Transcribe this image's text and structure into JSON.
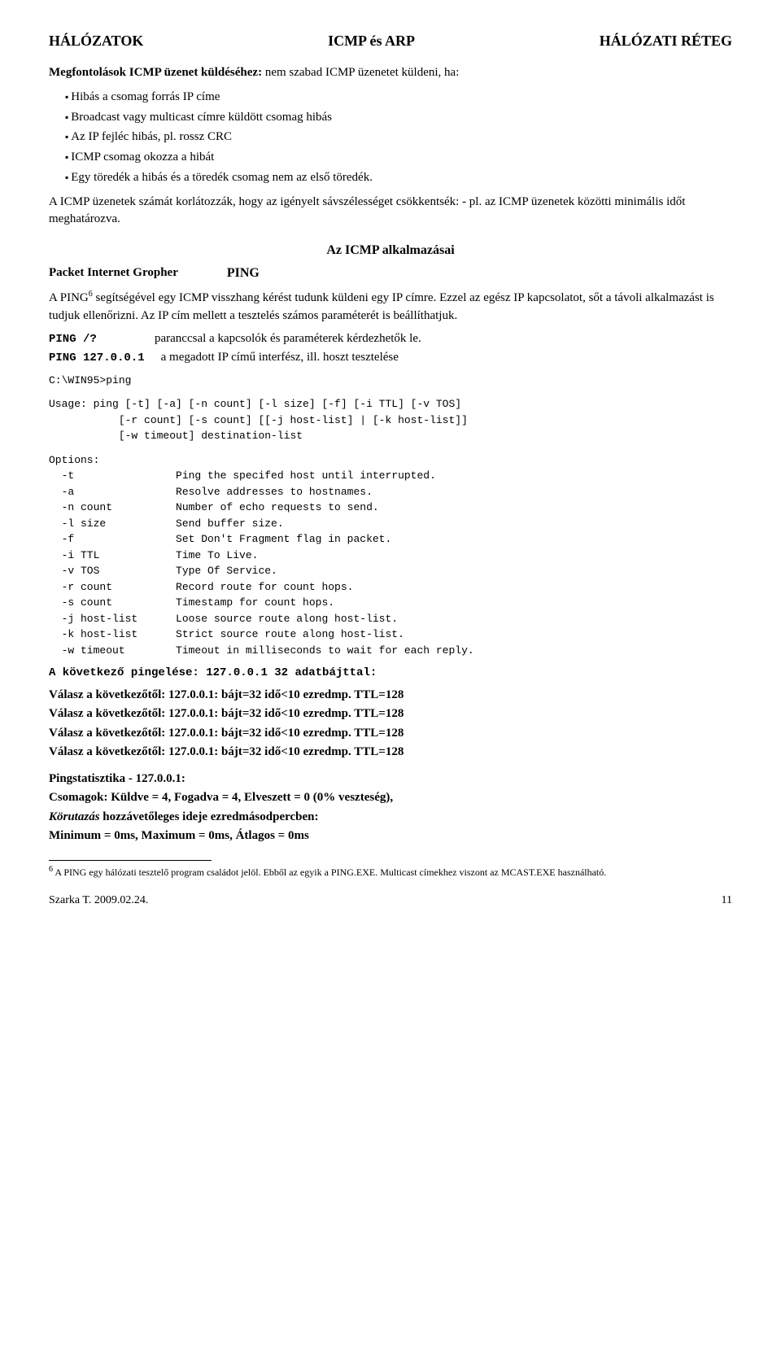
{
  "header": {
    "left": "HÁLÓZATOK",
    "center": "ICMP és ARP",
    "right": "HÁLÓZATI RÉTEG"
  },
  "intro": {
    "bold_prefix": "Megfontolások ICMP üzenet küldéséhez:",
    "bold_suffix": " nem szabad ICMP üzenetet küldeni, ha:",
    "bullets": [
      "Hibás a csomag forrás IP címe",
      "Broadcast vagy multicast címre küldött csomag hibás",
      "Az IP fejléc hibás, pl. rossz CRC",
      "ICMP csomag okozza a hibát",
      "Egy töredék a hibás és a töredék csomag nem az első töredék."
    ]
  },
  "limitation": {
    "text1": "A ICMP üzenetek számát korlátozzák, hogy az igényelt sávszélességet csökkentsék: - pl. az ICMP üzenetek közötti minimális időt meghatározva."
  },
  "section_title": "Az ICMP alkalmazásai",
  "ping_header": {
    "left": "Packet Internet Gropher",
    "right": "PING"
  },
  "ping_intro": {
    "text": "A PING",
    "superscript": "6",
    "text2": " segítségével egy ICMP visszhang kérést tudunk küldeni egy IP címre. Ezzel az egész IP kapcsolatot, sőt a távoli alkalmazást is tudjuk ellenőrizni. Az IP cím mellett a tesztelés számos paraméterét is beállíthatjuk."
  },
  "ping_help": {
    "cmd": "PING /?",
    "desc": "paranccsal a kapcsolók és paraméterek kérdezhetők le."
  },
  "ping_local": {
    "cmd": "PING 127.0.0.1",
    "desc": "a megadott IP című interfész, ill. hoszt tesztelése"
  },
  "code_prompt": "C:\\WIN95>ping",
  "usage_block": "Usage: ping [-t] [-a] [-n count] [-l size] [-f] [-i TTL] [-v TOS]\n           [-r count] [-s count] [[-j host-list] | [-k host-list]]\n           [-w timeout] destination-list",
  "options_block": "Options:\n  -t                Ping the specifed host until interrupted.\n  -a                Resolve addresses to hostnames.\n  -n count          Number of echo requests to send.\n  -l size           Send buffer size.\n  -f                Set Don't Fragment flag in packet.\n  -i TTL            Time To Live.\n  -v TOS            Type Of Service.\n  -r count          Record route for count hops.\n  -s count          Timestamp for count hops.\n  -j host-list      Loose source route along host-list.\n  -k host-list      Strict source route along host-list.\n  -w timeout        Timeout in milliseconds to wait for each reply.",
  "next_ping": {
    "text": "A következő pingelése: 127.0.0.1   32 adatbájttal:"
  },
  "replies": [
    "Válasz a következőtől: 127.0.0.1: bájt=32 idő<10 ezredmp. TTL=128",
    "Válasz a következőtől: 127.0.0.1: bájt=32 idő<10 ezredmp. TTL=128",
    "Válasz a következőtől: 127.0.0.1: bájt=32 idő<10 ezredmp. TTL=128",
    "Válasz a következőtől: 127.0.0.1: bájt=32 idő<10 ezredmp. TTL=128"
  ],
  "pingstat": {
    "line1": "Pingstatisztika - 127.0.0.1:",
    "line2": "    Csomagok: Küldve = 4, Fogadva = 4, Elveszett = 0 (0% veszteség),",
    "line3_italic": "Körutazás",
    "line3_rest": " hozzávetőleges ideje ezredmásodpercben:",
    "line4": "    Minimum = 0ms, Maximum =  0ms, Átlagos =  0ms"
  },
  "footnote": {
    "number": "6",
    "text": " A PING egy hálózati tesztelő program családot jelöl. Ebből az egyik a PING.EXE. Multicast címekhez viszont az MCAST.EXE használható."
  },
  "footer": {
    "author": "Szarka T.",
    "date": "2009.02.24.",
    "page": "11"
  }
}
